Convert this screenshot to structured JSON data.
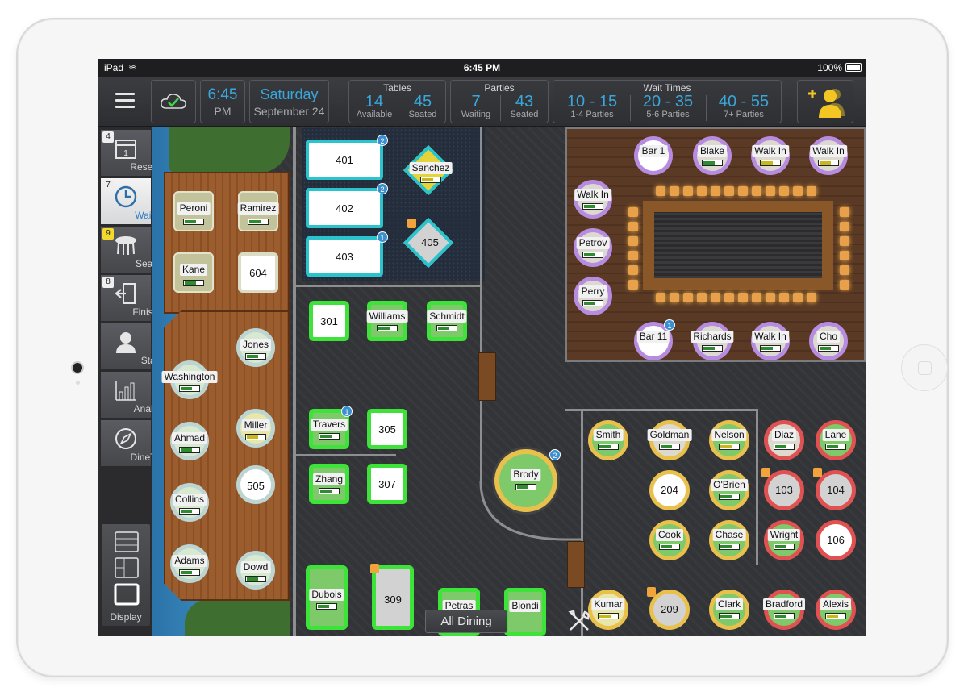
{
  "status": {
    "device": "iPad",
    "time": "6:45 PM",
    "battery": "100%"
  },
  "header": {
    "clock_time": "6:45",
    "clock_ampm": "PM",
    "day": "Saturday",
    "date": "September 24",
    "tables": {
      "label": "Tables",
      "available_value": "14",
      "available_label": "Available",
      "seated_value": "45",
      "seated_label": "Seated"
    },
    "parties": {
      "label": "Parties",
      "waiting_value": "7",
      "waiting_label": "Waiting",
      "seated_value": "43",
      "seated_label": "Seated"
    },
    "wait_times": {
      "label": "Wait Times",
      "items": [
        {
          "value": "10 - 15",
          "label": "1-4 Parties"
        },
        {
          "value": "20 - 35",
          "label": "5-6 Parties"
        },
        {
          "value": "40 - 55",
          "label": "7+ Parties"
        }
      ]
    }
  },
  "sidebar": {
    "items": [
      {
        "label": "Reserved",
        "count": "4"
      },
      {
        "label": "Waiting",
        "count": "7"
      },
      {
        "label": "Seated",
        "count": "9"
      },
      {
        "label": "Finished",
        "count": "8"
      },
      {
        "label": "Staff"
      },
      {
        "label": "Analyze"
      },
      {
        "label": "DineTime"
      }
    ],
    "display_label": "Display"
  },
  "tables": {
    "peroni": "Peroni",
    "ramirez": "Ramirez",
    "kane": "Kane",
    "t604": "604",
    "jones": "Jones",
    "washington": "Washington",
    "ahmad": "Ahmad",
    "miller": "Miller",
    "t505": "505",
    "collins": "Collins",
    "adams": "Adams",
    "dowd": "Dowd",
    "t401": "401",
    "t402": "402",
    "t403": "403",
    "sanchez": "Sanchez",
    "t405": "405",
    "t301": "301",
    "williams": "Williams",
    "schmidt": "Schmidt",
    "travers": "Travers",
    "t305": "305",
    "zhang": "Zhang",
    "t307": "307",
    "dubois": "Dubois",
    "t309": "309",
    "petras": "Petras",
    "biondi": "Biondi",
    "brody": "Brody",
    "bar1": "Bar 1",
    "blake": "Blake",
    "walkin1": "Walk In",
    "walkin2": "Walk In",
    "walkin3": "Walk In",
    "petrov": "Petrov",
    "perry": "Perry",
    "bar11": "Bar 11",
    "richards": "Richards",
    "walkin4": "Walk In",
    "cho": "Cho",
    "smith": "Smith",
    "goldman": "Goldman",
    "nelson": "Nelson",
    "diaz": "Diaz",
    "lane": "Lane",
    "t204": "204",
    "obrien": "O'Brien",
    "t103": "103",
    "t104": "104",
    "cook": "Cook",
    "chase": "Chase",
    "wright": "Wright",
    "t106": "106",
    "kumar": "Kumar",
    "t209": "209",
    "clark": "Clark",
    "bradford": "Bradford",
    "alexis": "Alexis"
  },
  "badges": {
    "b401": "2",
    "b402": "2",
    "b403": "1",
    "btravers": "1",
    "bbrody": "2",
    "bbar11": "1"
  },
  "footer": {
    "section_label": "All Dining"
  },
  "colors": {
    "accent": "#39a7dc",
    "green_ring": "#3ee33a",
    "teal_ring": "#2bc3cc",
    "purple_ring": "#b78be0",
    "gold_ring": "#e9c04c",
    "red_ring": "#e05252"
  }
}
